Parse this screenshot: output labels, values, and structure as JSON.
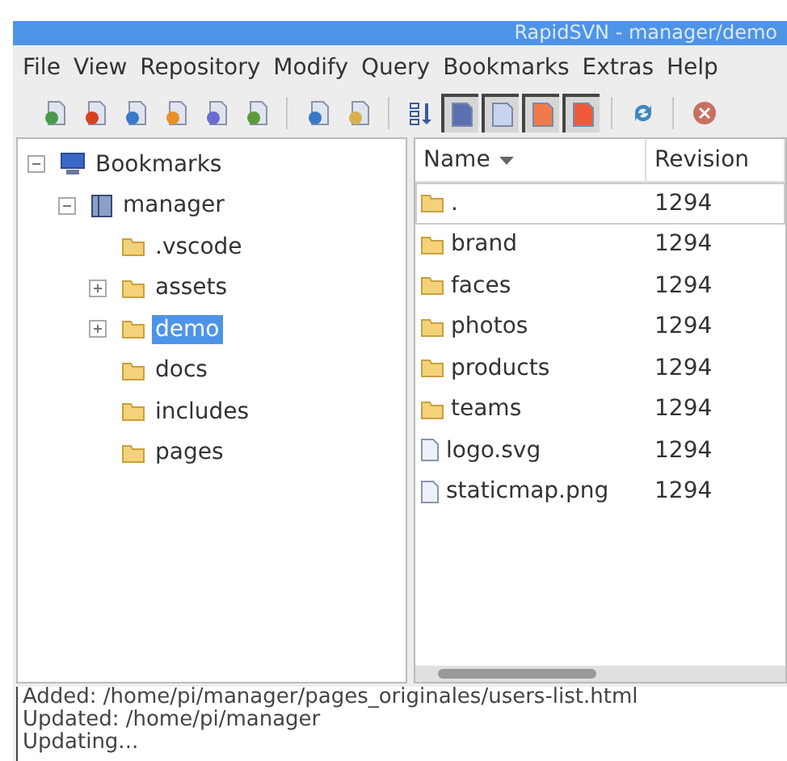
{
  "window": {
    "title": "RapidSVN - manager/demo"
  },
  "menu": [
    "File",
    "View",
    "Repository",
    "Modify",
    "Query",
    "Bookmarks",
    "Extras",
    "Help"
  ],
  "toolbar": [
    {
      "kind": "add",
      "pressed": false
    },
    {
      "kind": "delete",
      "pressed": false
    },
    {
      "kind": "update",
      "pressed": false
    },
    {
      "kind": "commit",
      "pressed": false
    },
    {
      "kind": "revert",
      "pressed": false
    },
    {
      "kind": "resolve",
      "pressed": false
    },
    {
      "kind": "separator"
    },
    {
      "kind": "info",
      "pressed": false
    },
    {
      "kind": "log",
      "pressed": false
    },
    {
      "kind": "separator"
    },
    {
      "kind": "flat",
      "pressed": false
    },
    {
      "kind": "unversioned",
      "pressed": true
    },
    {
      "kind": "unmodified",
      "pressed": true
    },
    {
      "kind": "modified",
      "pressed": true
    },
    {
      "kind": "conflicted",
      "pressed": true
    },
    {
      "kind": "separator"
    },
    {
      "kind": "refresh",
      "pressed": false
    },
    {
      "kind": "separator"
    },
    {
      "kind": "stop",
      "pressed": false
    }
  ],
  "tree": [
    {
      "label": "Bookmarks",
      "kind": "computer",
      "expanded": true,
      "selected": false,
      "children": [
        {
          "label": "manager",
          "kind": "book",
          "expanded": true,
          "selected": false,
          "children": [
            {
              "label": ".vscode",
              "kind": "folder",
              "selected": false
            },
            {
              "label": "assets",
              "kind": "folder",
              "expanded": false,
              "selected": false
            },
            {
              "label": "demo",
              "kind": "folder",
              "expanded": false,
              "selected": true
            },
            {
              "label": "docs",
              "kind": "folder",
              "selected": false
            },
            {
              "label": "includes",
              "kind": "folder",
              "selected": false
            },
            {
              "label": "pages",
              "kind": "folder",
              "selected": false
            }
          ]
        }
      ]
    }
  ],
  "file_list": {
    "columns": [
      "Name",
      "Revision"
    ],
    "rows": [
      {
        "name": ".",
        "revision": "1294",
        "kind": "folder",
        "focused": true
      },
      {
        "name": "brand",
        "revision": "1294",
        "kind": "folder",
        "focused": false
      },
      {
        "name": "faces",
        "revision": "1294",
        "kind": "folder",
        "focused": false
      },
      {
        "name": "photos",
        "revision": "1294",
        "kind": "folder",
        "focused": false
      },
      {
        "name": "products",
        "revision": "1294",
        "kind": "folder",
        "focused": false
      },
      {
        "name": "teams",
        "revision": "1294",
        "kind": "folder",
        "focused": false
      },
      {
        "name": "logo.svg",
        "revision": "1294",
        "kind": "file",
        "focused": false
      },
      {
        "name": "staticmap.png",
        "revision": "1294",
        "kind": "file",
        "focused": false
      }
    ]
  },
  "log": [
    "Added: /home/pi/manager/pages_originales/users-list.html",
    "Updated: /home/pi/manager",
    "Updating..."
  ]
}
